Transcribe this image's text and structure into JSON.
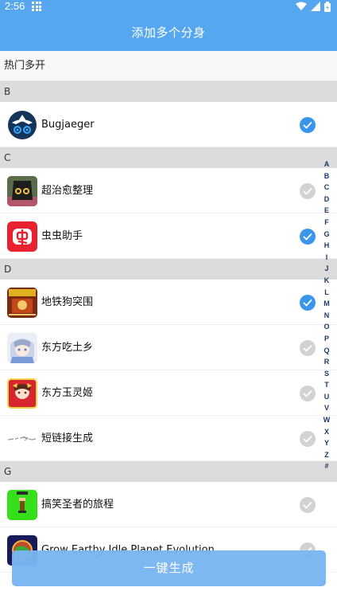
{
  "status": {
    "time": "2:56"
  },
  "header": {
    "title": "添加多个分身"
  },
  "hot": {
    "label": "热门多开"
  },
  "sections": [
    {
      "letter": "B"
    },
    {
      "letter": "C"
    },
    {
      "letter": "D"
    },
    {
      "letter": "G"
    }
  ],
  "apps": [
    {
      "name": "Bugjaeger",
      "checked": true
    },
    {
      "name": "超治愈整理",
      "checked": false
    },
    {
      "name": "虫虫助手",
      "checked": true
    },
    {
      "name": "地铁狗突围",
      "checked": true
    },
    {
      "name": "东方吃土乡",
      "checked": false
    },
    {
      "name": "东方玉灵姬",
      "checked": false
    },
    {
      "name": "短链接生成",
      "checked": false
    },
    {
      "name": "搞笑圣者的旅程",
      "checked": false
    },
    {
      "name": "Grow Earthy Idle Planet Evolution",
      "checked": false
    }
  ],
  "alphabet": [
    "A",
    "B",
    "C",
    "D",
    "E",
    "F",
    "G",
    "H",
    "I",
    "J",
    "K",
    "L",
    "M",
    "N",
    "O",
    "P",
    "Q",
    "R",
    "S",
    "T",
    "U",
    "V",
    "W",
    "X",
    "Y",
    "Z",
    "#"
  ],
  "button": {
    "label": "一键生成"
  },
  "colors": {
    "primary": "#56A6F0",
    "check_on": "#3a96ec",
    "check_off": "#d2d2d2"
  }
}
